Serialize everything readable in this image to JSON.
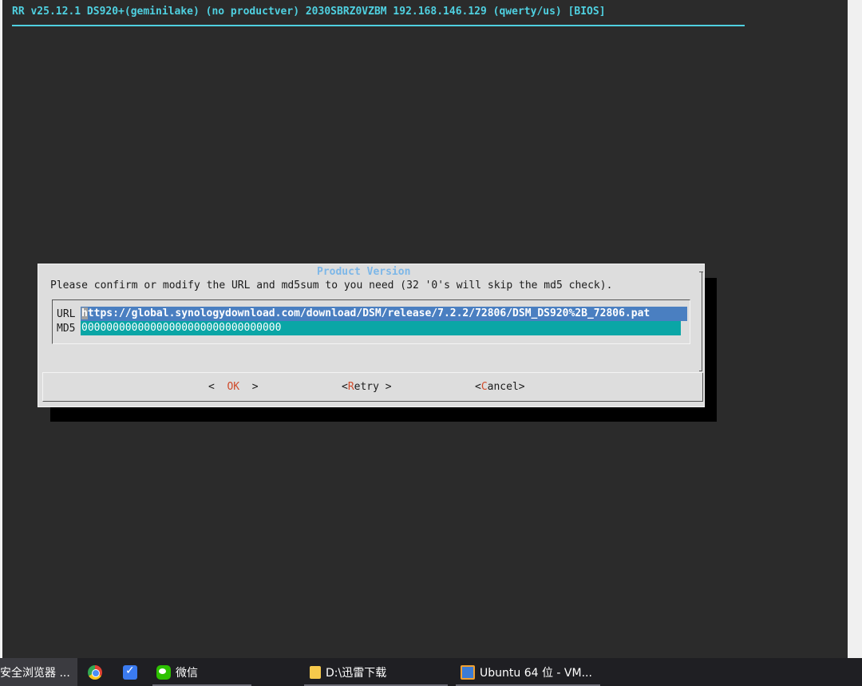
{
  "terminal": {
    "header": "RR v25.12.1 DS920+(geminilake) (no productver) 2030SBRZ0VZBM 192.168.146.129 (qwerty/us) [BIOS]"
  },
  "dialog": {
    "title": "Product Version",
    "prompt": "Please confirm or modify the URL and md5sum to you need (32 '0's will skip the md5 check).",
    "url_label": "URL",
    "url_cursor_char": "h",
    "url_value_rest": "ttps://global.synologydownload.com/download/DSM/release/7.2.2/72806/DSM_DS920%2B_72806.pat",
    "md5_label": "MD5",
    "md5_value": "00000000000000000000000000000000",
    "buttons": {
      "ok_left": "<  ",
      "ok_hot": "OK",
      "ok_right": "  >",
      "retry_left": "<",
      "retry_hot": "R",
      "retry_rest": "etry >",
      "cancel_left": "<",
      "cancel_hot": "C",
      "cancel_rest": "ancel>"
    }
  },
  "taskbar": {
    "items": [
      {
        "label": "安全浏览器 ..."
      },
      {
        "label": "微信"
      },
      {
        "label": "D:\\迅雷下载"
      },
      {
        "label": "Ubuntu 64 位 - VM..."
      }
    ]
  },
  "colors": {
    "terminal_bg": "#2b2b2b",
    "header_text": "#4fd0e0",
    "dialog_bg": "#dddddd",
    "title_text": "#7db7e8",
    "url_field": "#4a7fc1",
    "md5_field": "#0aa6a6",
    "hotkey": "#d04a2a"
  }
}
